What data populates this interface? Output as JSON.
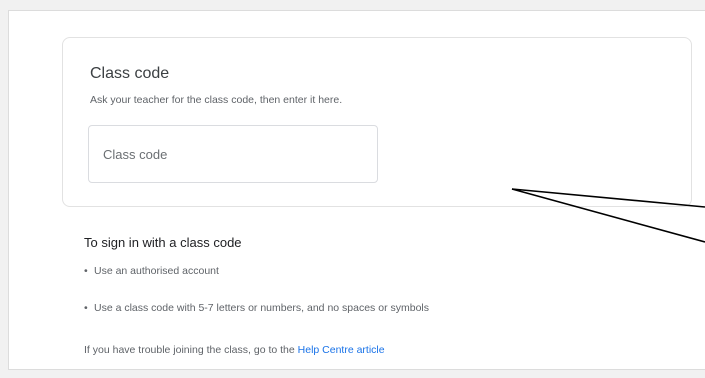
{
  "class_code_card": {
    "title": "Class code",
    "subtitle": "Ask your teacher for the class code, then enter it here.",
    "input_placeholder": "Class code",
    "input_value": ""
  },
  "help": {
    "title": "To sign in with a class code",
    "bullets": [
      "Use an authorised account",
      "Use a class code with 5-7 letters or numbers, and no spaces or symbols"
    ],
    "trouble_prefix": "If you have trouble joining the class, go to the",
    "trouble_link": "Help Centre article"
  },
  "colors": {
    "link": "#1a73e8",
    "text_primary": "#202124",
    "text_secondary": "#5f6368",
    "card_border": "#e2e2e2",
    "callout_line": "#000000"
  }
}
